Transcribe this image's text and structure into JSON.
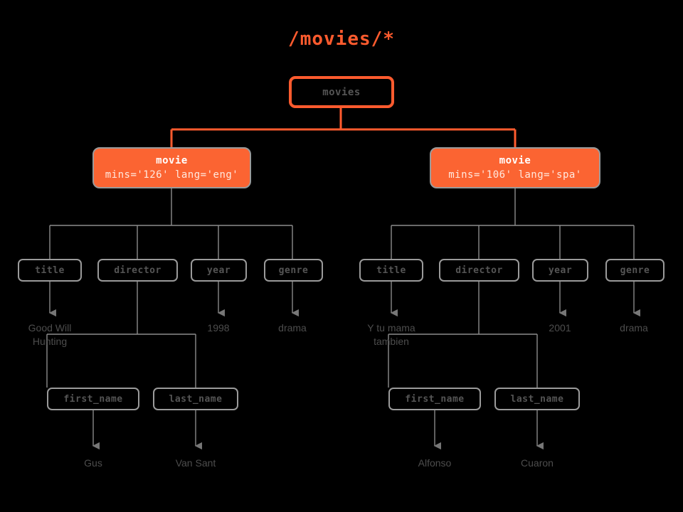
{
  "title": "/movies/*",
  "colors": {
    "accent": "#ff5b2e",
    "node_fill": "#fb6432",
    "node_border": "#9a9a9a",
    "text_gray": "#4d4d4d",
    "background": "#000000"
  },
  "tree": {
    "root": {
      "label": "movies"
    },
    "movies": [
      {
        "tag": "movie",
        "attrs": "mins='126' lang='eng'",
        "children": [
          {
            "label": "title",
            "value": "Good Will\nHunting"
          },
          {
            "label": "director",
            "children": [
              {
                "label": "first_name",
                "value": "Gus"
              },
              {
                "label": "last_name",
                "value": "Van Sant"
              }
            ]
          },
          {
            "label": "year",
            "value": "1998"
          },
          {
            "label": "genre",
            "value": "drama"
          }
        ]
      },
      {
        "tag": "movie",
        "attrs": "mins='106' lang='spa'",
        "children": [
          {
            "label": "title",
            "value": "Y tu mama\ntambien"
          },
          {
            "label": "director",
            "children": [
              {
                "label": "first_name",
                "value": "Alfonso"
              },
              {
                "label": "last_name",
                "value": "Cuaron"
              }
            ]
          },
          {
            "label": "year",
            "value": "2001"
          },
          {
            "label": "genre",
            "value": "drama"
          }
        ]
      }
    ]
  }
}
